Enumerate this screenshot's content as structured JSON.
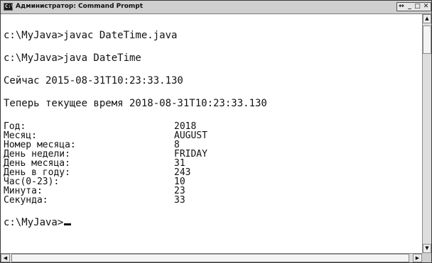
{
  "window": {
    "title": "Администратор: Command Prompt",
    "icon": "C:\\"
  },
  "title_buttons": {
    "sysmenu": "↔",
    "minimize": "_",
    "maximize": "□",
    "close": "✕"
  },
  "console": {
    "cmd1": "c:\\MyJava>javac DateTime.java",
    "cmd2": "c:\\MyJava>java DateTime",
    "now": "Сейчас 2015-08-31T10:23:33.130",
    "current": "Теперь текущее время 2018-08-31T10:23:33.130",
    "rows": [
      {
        "label": "Год:",
        "value": "2018"
      },
      {
        "label": "Месяц:",
        "value": "AUGUST"
      },
      {
        "label": "Номер месяца:",
        "value": "8"
      },
      {
        "label": "День недели:",
        "value": "FRIDAY"
      },
      {
        "label": "День месяца:",
        "value": "31"
      },
      {
        "label": "День в году:",
        "value": "243"
      },
      {
        "label": "Час(0-23):",
        "value": "10"
      },
      {
        "label": "Минута:",
        "value": "23"
      },
      {
        "label": "Секунда:",
        "value": "33"
      }
    ],
    "prompt": "c:\\MyJava>"
  },
  "scrollbars": {
    "up": "▲",
    "down": "▼",
    "left": "◀",
    "right": "▶"
  }
}
